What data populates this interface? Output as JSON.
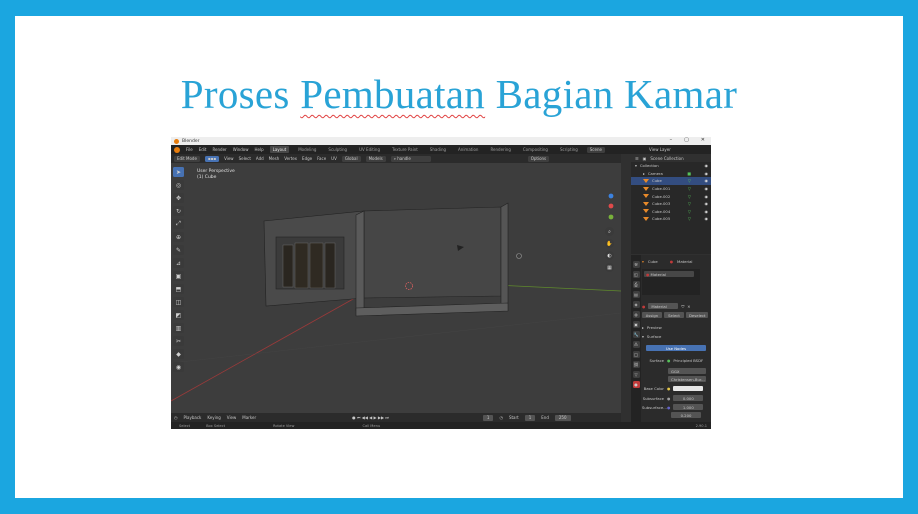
{
  "slide": {
    "title_prefix": "Proses ",
    "title_spell": "Pembuatan",
    "title_suffix": " Bagian Kamar"
  },
  "window": {
    "app_title": "Blender",
    "controls": [
      "–",
      "▢",
      "✕"
    ]
  },
  "menubar": {
    "menus": [
      "File",
      "Edit",
      "Render",
      "Window",
      "Help"
    ],
    "workspaces": [
      "Layout",
      "Modeling",
      "Sculpting",
      "UV Editing",
      "Texture Paint",
      "Shading",
      "Animation",
      "Rendering",
      "Compositing",
      "Scripting"
    ],
    "active_workspace": "Layout",
    "scene_label": "Scene",
    "view_layer_label": "View Layer"
  },
  "viewport_header": {
    "mode": "Edit Mode",
    "menus": [
      "View",
      "Select",
      "Add",
      "Mesh",
      "Vertex",
      "Edge",
      "Face",
      "UV"
    ],
    "transform": "Global",
    "snap_label": "Models",
    "search_value": "handle",
    "options_label": "Options"
  },
  "viewport": {
    "info_line1": "User Perspective",
    "info_line2": "(1) Cube"
  },
  "timeline": {
    "menus": [
      "Playback",
      "Keying",
      "View",
      "Marker"
    ],
    "current_frame": "1",
    "start_label": "Start",
    "start_value": "1",
    "end_label": "End",
    "end_value": "250"
  },
  "statusbar": {
    "items": [
      "Select",
      "Box Select",
      "Rotate View",
      "Call Menu"
    ],
    "version": "2.90.1"
  },
  "outliner": {
    "header": "Scene Collection",
    "items": [
      {
        "label": "Collection"
      },
      {
        "label": "Camera"
      },
      {
        "label": "Cube"
      },
      {
        "label": "Cube.001"
      },
      {
        "label": "Cube.002"
      },
      {
        "label": "Cube.003"
      },
      {
        "label": "Cube.004"
      },
      {
        "label": "Cube.005"
      }
    ]
  },
  "properties": {
    "object_name": "Cube",
    "tab_label": "Material",
    "slot_label": "Material",
    "material_name": "Material",
    "assign": "Assign",
    "select": "Select",
    "deselect": "Deselect",
    "preview": "Preview",
    "surface_section": "Surface",
    "use_nodes": "Use Nodes",
    "surface_label": "Surface",
    "surface_value": "Principled BSDF",
    "distribution": "GGX",
    "subsurface_method": "Christensen-Bur...",
    "base_color_label": "Base Color",
    "subsurface_label": "Subsurface",
    "subsurface_value": "0.000",
    "subsurface_radius_label": "Subsurface...",
    "radius_1": "1.000",
    "radius_2": "0.200"
  }
}
